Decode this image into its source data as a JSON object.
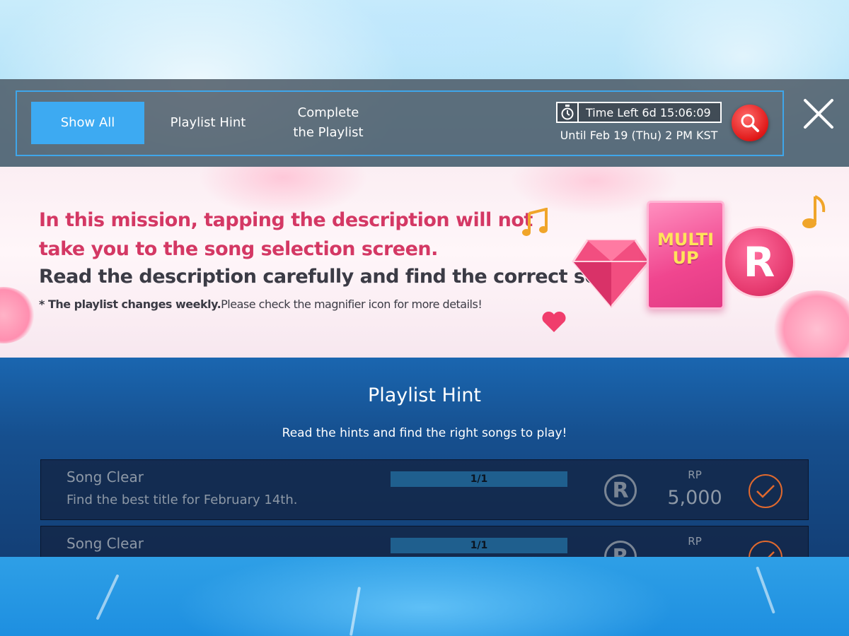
{
  "tabs": [
    {
      "label": "Show All",
      "active": true
    },
    {
      "label": "Playlist Hint",
      "active": false
    },
    {
      "label": "Complete\nthe Playlist",
      "active": false
    }
  ],
  "timer": {
    "label": "Time Left 6d 15:06:09",
    "until": "Until Feb 19 (Thu) 2 PM KST",
    "icon": "stopwatch-icon"
  },
  "icons": {
    "search": "search-icon",
    "close": "close-icon"
  },
  "banner": {
    "line1": "In this mission, tapping the description will not",
    "line2": "take you to the song selection screen.",
    "line3": "Read the description carefully and find the correct song!",
    "line4_bold": "* The playlist changes weekly.",
    "line4_rest": "Please check the magnifier icon for more details!",
    "card_text": "MULTI UP",
    "coin_text": "R"
  },
  "section": {
    "title": "Playlist Hint",
    "subtitle": "Read the hints and find the right songs to play!"
  },
  "missions": [
    {
      "type": "Song Clear",
      "description": "Find the best title for February 14th.",
      "progress": "1/1",
      "reward_icon": "R",
      "reward_label": "RP",
      "reward_value": "5,000",
      "completed": true
    },
    {
      "type": "Song Clear",
      "progress": "1/1",
      "reward_icon": "R",
      "reward_label": "RP",
      "completed": true
    }
  ],
  "colors": {
    "accent_tab": "#3daaf2",
    "banner_pink": "#d43864",
    "check_orange": "#e0692e",
    "search_red": "#e01818"
  }
}
